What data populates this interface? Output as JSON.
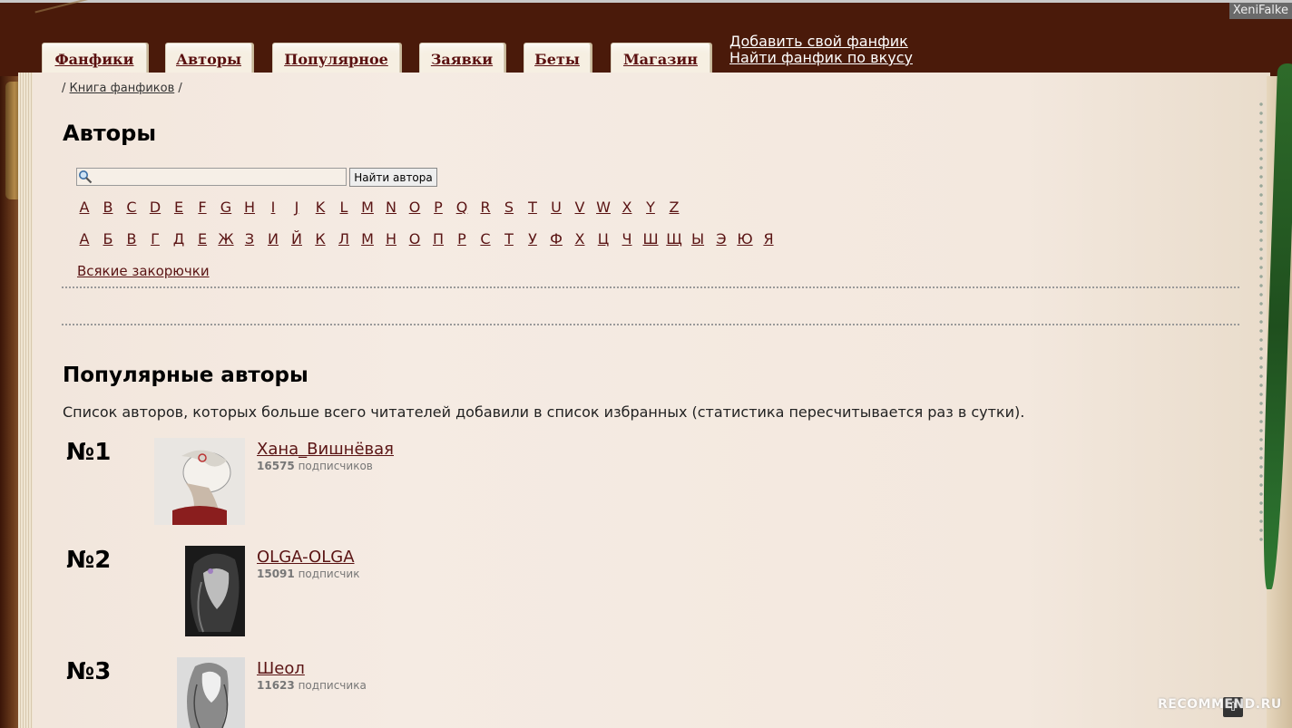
{
  "header": {
    "username": "XeniFalke",
    "tabs": [
      "Фанфики",
      "Авторы",
      "Популярное",
      "Заявки",
      "Беты",
      "Магазин"
    ],
    "links": [
      "Добавить свой фанфик",
      "Найти фанфик по вкусу"
    ]
  },
  "breadcrumb": {
    "sep": "/",
    "link": "Книга фанфиков"
  },
  "page": {
    "title": "Авторы",
    "search": {
      "button": "Найти автора",
      "value": ""
    },
    "latin": [
      "A",
      "B",
      "C",
      "D",
      "E",
      "F",
      "G",
      "H",
      "I",
      "J",
      "K",
      "L",
      "M",
      "N",
      "O",
      "P",
      "Q",
      "R",
      "S",
      "T",
      "U",
      "V",
      "W",
      "X",
      "Y",
      "Z"
    ],
    "cyrillic": [
      "А",
      "Б",
      "В",
      "Г",
      "Д",
      "Е",
      "Ж",
      "З",
      "И",
      "Й",
      "К",
      "Л",
      "М",
      "Н",
      "О",
      "П",
      "Р",
      "С",
      "Т",
      "У",
      "Ф",
      "Х",
      "Ц",
      "Ч",
      "Ш",
      "Щ",
      "Ы",
      "Э",
      "Ю",
      "Я"
    ],
    "misc_link": "Всякие закорючки"
  },
  "popular": {
    "title": "Популярные авторы",
    "description": "Список авторов, которых больше всего читателей добавили в список избранных (статистика пересчитывается раз в сутки).",
    "authors": [
      {
        "rank": "№1",
        "name": "Хана_Вишнёвая",
        "count": "16575",
        "label": "подписчиков"
      },
      {
        "rank": "№2",
        "name": "OLGA-OLGA",
        "count": "15091",
        "label": "подписчик"
      },
      {
        "rank": "№3",
        "name": "Шеол",
        "count": "11623",
        "label": "подписчика"
      }
    ]
  },
  "footer": {
    "watermark": "RECOMMEND.RU",
    "up_icon": "⇧"
  },
  "colors": {
    "header_bg": "#4a1a0a",
    "link": "#5a1414",
    "paper": "#f4eae1"
  }
}
